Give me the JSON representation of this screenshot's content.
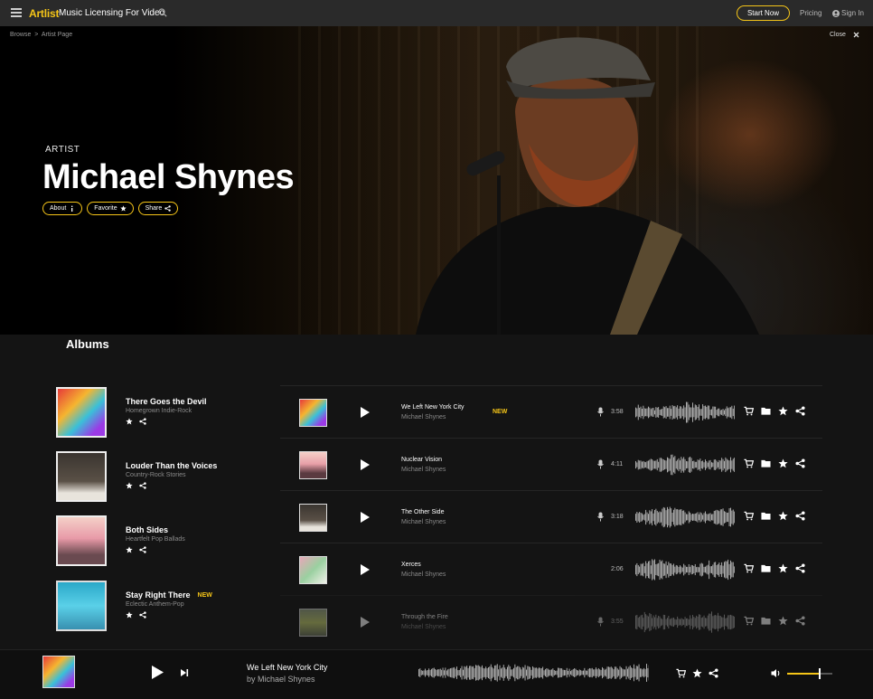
{
  "nav": {
    "logo": "Artlist",
    "site_title": "Music Licensing For Video",
    "start_now": "Start Now",
    "pricing": "Pricing",
    "sign_in": "Sign In"
  },
  "breadcrumb": {
    "browse": "Browse",
    "sep": ">",
    "current": "Artist Page"
  },
  "close_label": "Close",
  "hero": {
    "label": "ARTIST",
    "name": "Michael Shynes",
    "buttons": {
      "about": "About",
      "favorite": "Favorite",
      "share": "Share"
    }
  },
  "albums_title": "Albums",
  "albums": [
    {
      "title": "There Goes the Devil",
      "genre": "Homegrown Indie-Rock",
      "is_new": false
    },
    {
      "title": "Louder Than the Voices",
      "genre": "Country-Rock Stories",
      "is_new": false
    },
    {
      "title": "Both Sides",
      "genre": "Heartfelt Pop Ballads",
      "is_new": false
    },
    {
      "title": "Stay Right There",
      "genre": "Eclectic Anthem-Pop",
      "is_new": true
    }
  ],
  "new_label": "NEW",
  "tracks": [
    {
      "title": "We Left New York City",
      "artist": "Michael Shynes",
      "duration": "3:58",
      "is_new": true,
      "vocal": true
    },
    {
      "title": "Nuclear Vision",
      "artist": "Michael Shynes",
      "duration": "4:11",
      "is_new": false,
      "vocal": true
    },
    {
      "title": "The Other Side",
      "artist": "Michael Shynes",
      "duration": "3:18",
      "is_new": false,
      "vocal": true
    },
    {
      "title": "Xerces",
      "artist": "Michael Shynes",
      "duration": "2:06",
      "is_new": false,
      "vocal": false
    },
    {
      "title": "Through the Fire",
      "artist": "Michael Shynes",
      "duration": "3:55",
      "is_new": false,
      "vocal": true
    }
  ],
  "player": {
    "title": "We Left New York City",
    "artist": "by Michael Shynes",
    "volume": 0.7
  },
  "colors": {
    "accent": "#f5c518",
    "background": "#141414",
    "topbar": "#2a2a2a"
  }
}
